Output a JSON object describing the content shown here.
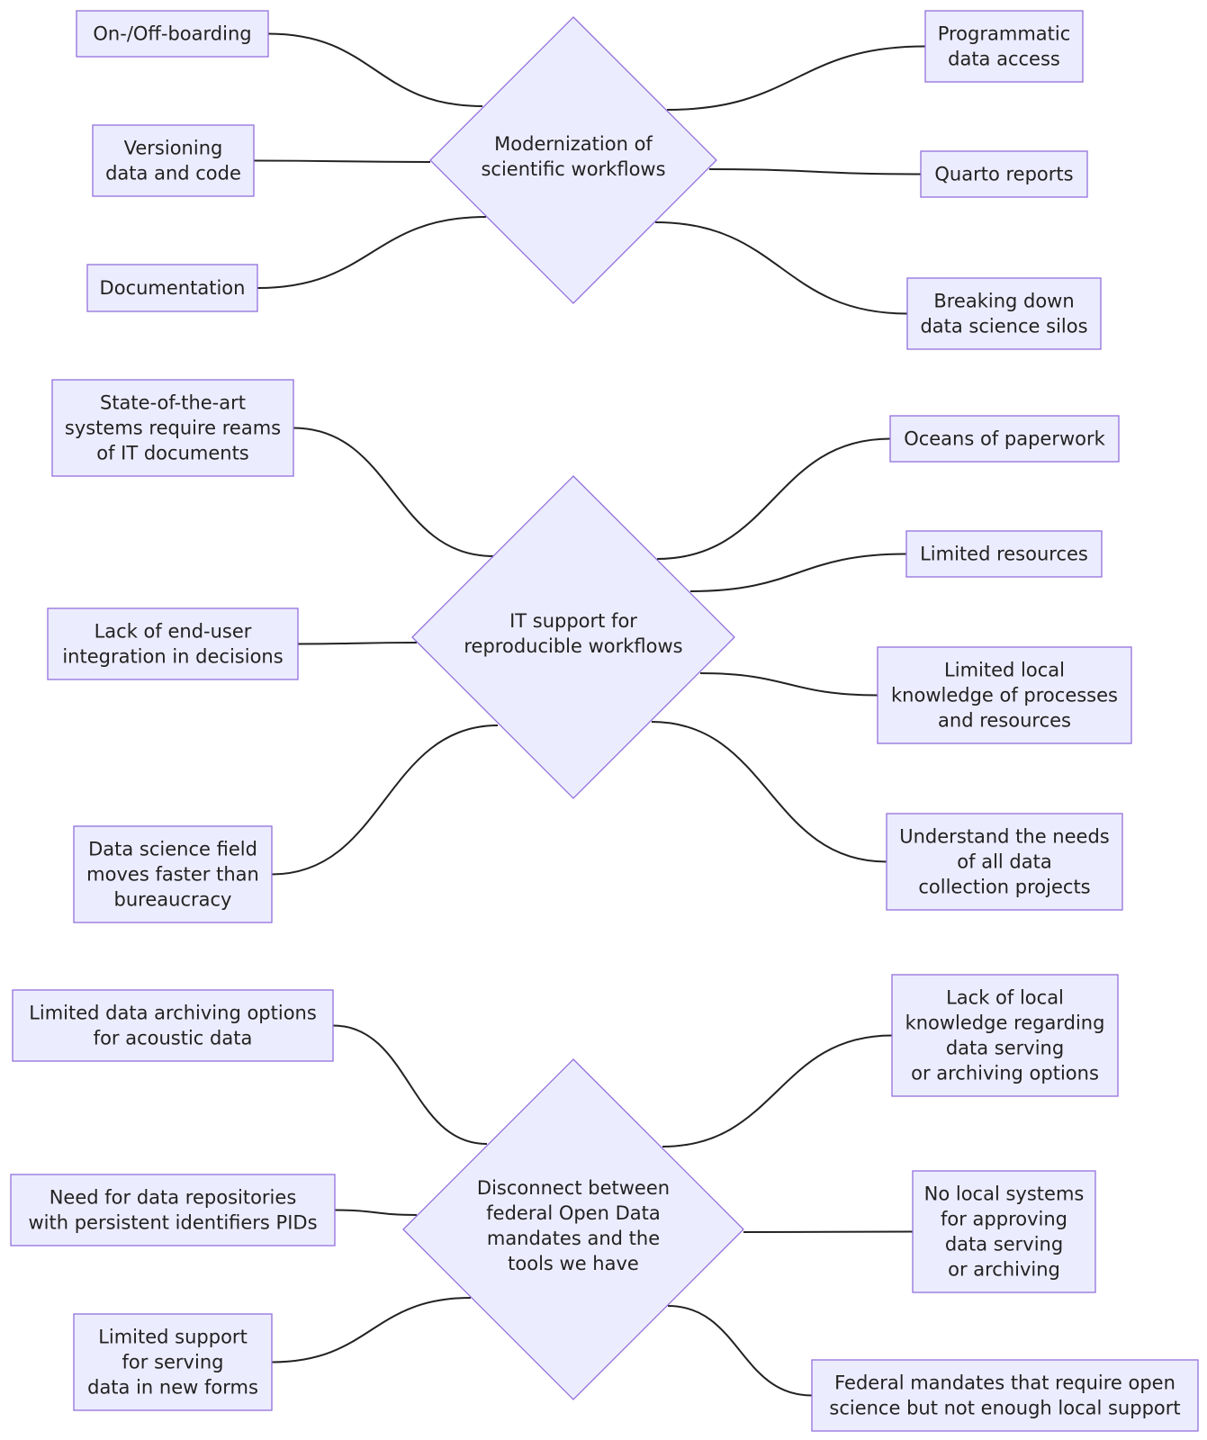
{
  "colors": {
    "node_fill": "#ECECFF",
    "node_border": "#9370DB",
    "edge": "#222222",
    "text": "#222222",
    "background": "#FFFFFF"
  },
  "groups": [
    {
      "id": "modernization",
      "hub": {
        "lines": [
          "Modernization of",
          "scientific workflows"
        ]
      },
      "left": [
        {
          "lines": [
            "On-/Off-boarding"
          ]
        },
        {
          "lines": [
            "Versioning",
            "data and code"
          ]
        },
        {
          "lines": [
            "Documentation"
          ]
        }
      ],
      "right": [
        {
          "lines": [
            "Programmatic",
            "data access"
          ]
        },
        {
          "lines": [
            "Quarto reports"
          ]
        },
        {
          "lines": [
            "Breaking down",
            "data science silos"
          ]
        }
      ]
    },
    {
      "id": "it-support",
      "hub": {
        "lines": [
          "IT support for",
          "reproducible workflows"
        ]
      },
      "left": [
        {
          "lines": [
            "State-of-the-art",
            "systems require reams",
            "of IT documents"
          ]
        },
        {
          "lines": [
            "Lack of end-user",
            "integration in decisions"
          ]
        },
        {
          "lines": [
            "Data science field",
            "moves faster than",
            "bureaucracy"
          ]
        }
      ],
      "right": [
        {
          "lines": [
            "Oceans of paperwork"
          ]
        },
        {
          "lines": [
            "Limited resources"
          ]
        },
        {
          "lines": [
            "Limited local",
            "knowledge of processes",
            "and resources"
          ]
        },
        {
          "lines": [
            "Understand the needs",
            "of all data",
            "collection projects"
          ]
        }
      ]
    },
    {
      "id": "open-data",
      "hub": {
        "lines": [
          "Disconnect between",
          "federal Open Data",
          "mandates and the",
          "tools we have"
        ]
      },
      "left": [
        {
          "lines": [
            "Limited data archiving options",
            "for acoustic data"
          ]
        },
        {
          "lines": [
            "Need for data repositories",
            "with persistent identifiers PIDs"
          ]
        },
        {
          "lines": [
            "Limited support",
            "for serving",
            "data in new forms"
          ]
        }
      ],
      "right": [
        {
          "lines": [
            "Lack of local",
            "knowledge regarding",
            "data serving",
            "or archiving options"
          ]
        },
        {
          "lines": [
            "No local systems",
            "for approving",
            "data serving",
            "or archiving"
          ]
        },
        {
          "lines": [
            "Federal mandates that require open",
            "science but not enough local support"
          ]
        }
      ]
    }
  ]
}
